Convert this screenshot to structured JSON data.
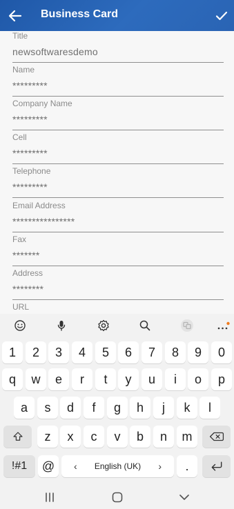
{
  "appbar": {
    "title": "Business Card",
    "back_icon": "arrow-left-icon",
    "confirm_icon": "checkmark-icon",
    "color": "#2d68b8"
  },
  "form": {
    "fields": [
      {
        "label": "Title",
        "value": "newsoftwaresdemo"
      },
      {
        "label": "Name",
        "value": "*********"
      },
      {
        "label": "Company Name",
        "value": "*********"
      },
      {
        "label": "Cell",
        "value": "*********"
      },
      {
        "label": "Telephone",
        "value": "*********"
      },
      {
        "label": "Email Address",
        "value": "****************"
      },
      {
        "label": "Fax",
        "value": "*******"
      },
      {
        "label": "Address",
        "value": "********"
      },
      {
        "label": "URL",
        "value": ""
      }
    ]
  },
  "keyboard": {
    "toolbar_icons": [
      "emoji-icon",
      "microphone-icon",
      "settings-icon",
      "search-icon",
      "translate-icon",
      "more-icon"
    ],
    "rows": [
      [
        "1",
        "2",
        "3",
        "4",
        "5",
        "6",
        "7",
        "8",
        "9",
        "0"
      ],
      [
        "q",
        "w",
        "e",
        "r",
        "t",
        "y",
        "u",
        "i",
        "o",
        "p"
      ],
      [
        "a",
        "s",
        "d",
        "f",
        "g",
        "h",
        "j",
        "k",
        "l"
      ],
      [
        "z",
        "x",
        "c",
        "v",
        "b",
        "n",
        "m"
      ]
    ],
    "symbols_key": "!#1",
    "at_key": "@",
    "space_label": "English (UK)",
    "period_key": ".",
    "notification_dot_color": "#f07b1e"
  },
  "navbar": {
    "icons": [
      "recent-apps-icon",
      "home-icon",
      "back-chevron-icon"
    ]
  }
}
